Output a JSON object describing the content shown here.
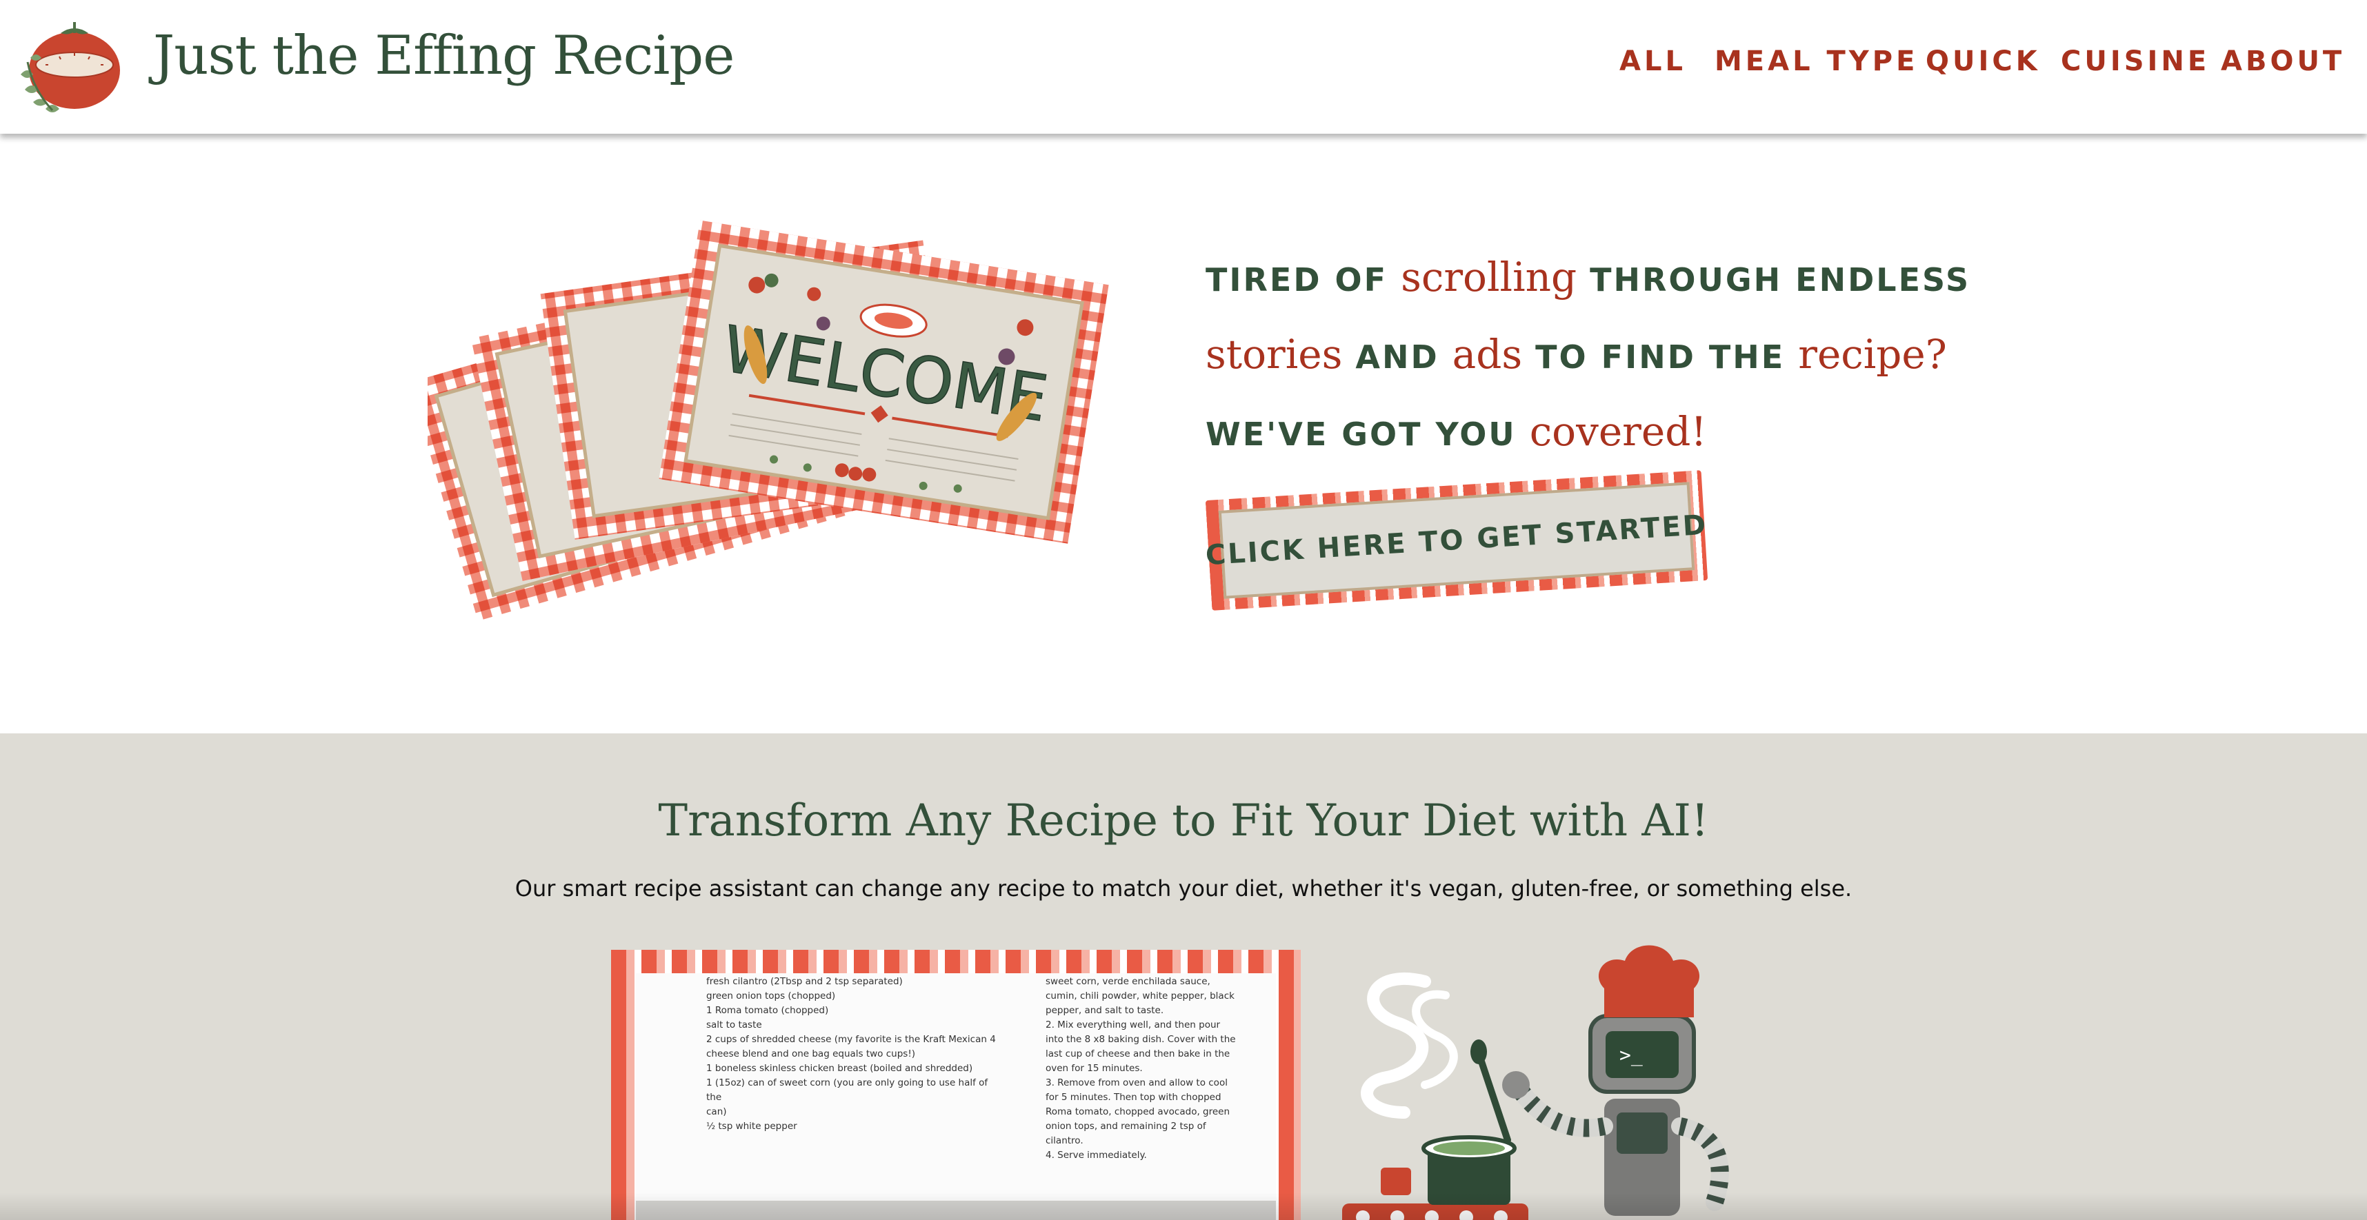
{
  "header": {
    "site_title": "Just the Effing Recipe",
    "nav": [
      {
        "label": "ALL"
      },
      {
        "label": "MEAL TYPE"
      },
      {
        "label": "QUICK"
      },
      {
        "label": "CUISINE"
      },
      {
        "label": "ABOUT"
      }
    ]
  },
  "hero": {
    "cards_text": "WELCOME",
    "tagline": [
      {
        "text": "TIRED OF ",
        "style": "caps"
      },
      {
        "text": "scrolling",
        "style": "script"
      },
      {
        "text": " THROUGH ENDLESS ",
        "style": "caps"
      },
      {
        "text": "stories",
        "style": "script"
      },
      {
        "text": " AND ",
        "style": "caps"
      },
      {
        "text": "ads",
        "style": "script"
      },
      {
        "text": " TO FIND THE ",
        "style": "caps"
      },
      {
        "text": "recipe?",
        "style": "script"
      },
      {
        "text": " WE'VE GOT YOU ",
        "style": "caps"
      },
      {
        "text": "covered!",
        "style": "script"
      }
    ],
    "cta_label": "CLICK HERE TO GET STARTED"
  },
  "ai_section": {
    "title": "Transform Any Recipe to Fit Your Diet with AI!",
    "subtitle": "Our smart recipe assistant can change any recipe to match your diet, whether it's vegan, gluten-free, or something else.",
    "recipe_preview": {
      "left_lines": [
        "fresh cilantro (2Tbsp and 2 tsp separated)",
        "green onion tops (chopped)",
        "1 Roma tomato (chopped)",
        "salt to taste",
        "2 cups of shredded cheese (my favorite is the Kraft Mexican 4",
        "cheese blend and one bag equals two cups!)",
        "1 boneless skinless chicken breast (boiled and shredded)",
        "1 (15oz) can of sweet corn (you are only going to use half of the",
        "can)",
        "½ tsp white pepper"
      ],
      "right_lines": [
        "sweet corn, verde enchilada sauce,",
        "cumin, chili powder, white pepper, black",
        "pepper, and salt to taste.",
        "2. Mix everything well, and then pour",
        "into the 8 x8 baking dish. Cover with the",
        "last cup of cheese and then bake in the",
        "oven for 15 minutes.",
        "3. Remove from oven and allow to cool",
        "for 5 minutes. Then top with chopped",
        "Roma tomato, chopped avocado, green",
        "onion tops, and remaining 2 tsp of",
        "cilantro.",
        "4. Serve immediately."
      ]
    }
  },
  "colors": {
    "brand_green": "#33503a",
    "brand_red": "#a8321e",
    "gingham_red": "#e95b45",
    "section_bg": "#dedcd5"
  },
  "icons": [
    "tomato-timer-logo-icon",
    "welcome-cards-illustration",
    "robot-chef-illustration"
  ]
}
